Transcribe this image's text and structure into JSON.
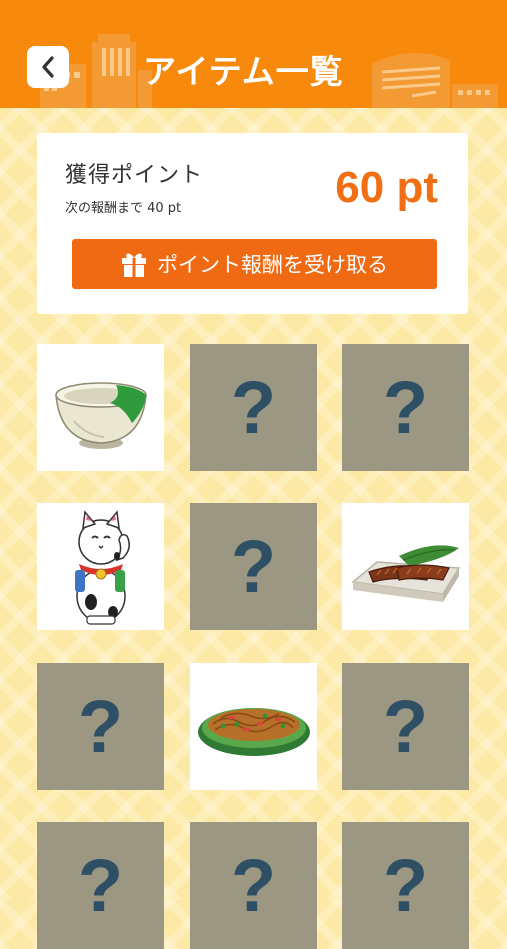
{
  "header": {
    "title": "アイテム一覧",
    "back_icon": "chevron-left-icon",
    "color": "#f7890d"
  },
  "points_card": {
    "label": "獲得ポイント",
    "next_reward": "次の報酬まで 40 pt",
    "value": "60 pt",
    "accent": "#f06e14",
    "reward_button": {
      "icon": "gift-icon",
      "label": "ポイント報酬を受け取る"
    }
  },
  "items": [
    {
      "status": "unlocked",
      "icon": "tea-bowl-icon"
    },
    {
      "status": "locked",
      "mark": "?"
    },
    {
      "status": "locked",
      "mark": "?"
    },
    {
      "status": "unlocked",
      "icon": "maneki-neko-icon"
    },
    {
      "status": "locked",
      "mark": "?"
    },
    {
      "status": "unlocked",
      "icon": "grilled-eel-icon"
    },
    {
      "status": "locked",
      "mark": "?"
    },
    {
      "status": "unlocked",
      "icon": "yakisoba-icon"
    },
    {
      "status": "locked",
      "mark": "?"
    },
    {
      "status": "locked",
      "mark": "?"
    },
    {
      "status": "locked",
      "mark": "?"
    },
    {
      "status": "locked",
      "mark": "?"
    }
  ]
}
